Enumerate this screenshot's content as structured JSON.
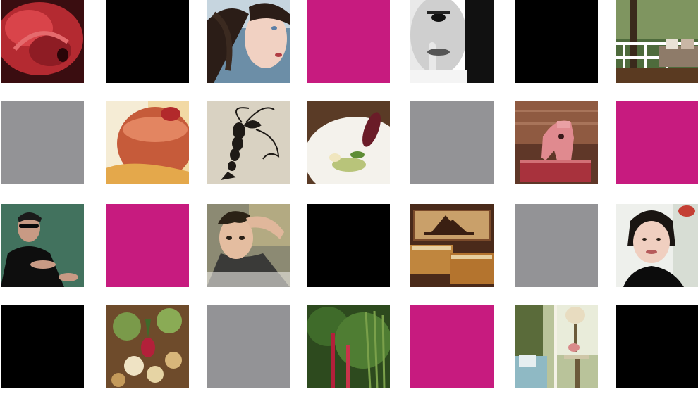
{
  "colors": {
    "magenta": "#c71b7f",
    "black": "#000000",
    "gray": "#939396",
    "background": "#ffffff"
  },
  "tiles": [
    {
      "kind": "photo",
      "subject": "red-rose"
    },
    {
      "kind": "color",
      "color": "black"
    },
    {
      "kind": "photo",
      "subject": "girl-hair-windblown"
    },
    {
      "kind": "color",
      "color": "magenta"
    },
    {
      "kind": "photo",
      "subject": "man-finger-on-lips"
    },
    {
      "kind": "color",
      "color": "black"
    },
    {
      "kind": "photo",
      "subject": "porch-with-pillows"
    },
    {
      "kind": "color",
      "color": "gray"
    },
    {
      "kind": "photo",
      "subject": "glass-of-red-drink"
    },
    {
      "kind": "photo",
      "subject": "lobster-illustration"
    },
    {
      "kind": "photo",
      "subject": "plated-dish"
    },
    {
      "kind": "color",
      "color": "gray"
    },
    {
      "kind": "photo",
      "subject": "pink-toy-horse-on-books"
    },
    {
      "kind": "color",
      "color": "magenta"
    },
    {
      "kind": "photo",
      "subject": "man-in-sunglasses-black-suit"
    },
    {
      "kind": "color",
      "color": "magenta"
    },
    {
      "kind": "photo",
      "subject": "man-hand-in-hair"
    },
    {
      "kind": "color",
      "color": "black"
    },
    {
      "kind": "photo",
      "subject": "vintage-tins-ship"
    },
    {
      "kind": "color",
      "color": "gray"
    },
    {
      "kind": "photo",
      "subject": "woman-dark-hair"
    },
    {
      "kind": "color",
      "color": "black"
    },
    {
      "kind": "photo",
      "subject": "salad-with-radish"
    },
    {
      "kind": "color",
      "color": "gray"
    },
    {
      "kind": "photo",
      "subject": "swiss-chard-greens"
    },
    {
      "kind": "color",
      "color": "magenta"
    },
    {
      "kind": "photo",
      "subject": "sunroom-with-lamp"
    },
    {
      "kind": "color",
      "color": "black"
    }
  ]
}
